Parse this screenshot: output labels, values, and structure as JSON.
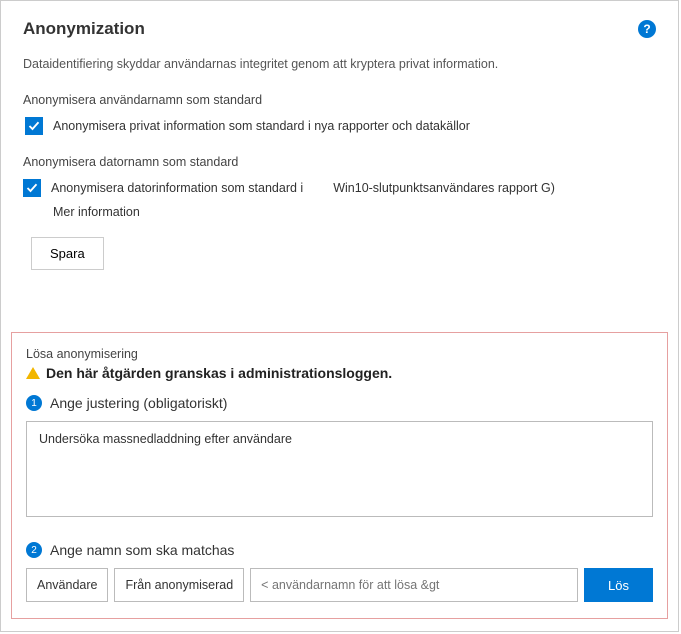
{
  "header": {
    "title": "Anonymization",
    "help_glyph": "?"
  },
  "description": "Dataidentifiering skyddar användarnas integritet genom att kryptera privat information.",
  "section1": {
    "label": "Anonymisera användarnamn som standard",
    "check_label": "Anonymisera privat information som standard i nya rapporter och datakällor"
  },
  "section2": {
    "label": "Anonymisera datornamn som standard",
    "check_label": "Anonymisera datorinformation som standard i",
    "extra": "Win10-slutpunktsanvändares rapport G)",
    "more_info": "Mer information"
  },
  "save_label": "Spara",
  "resolve": {
    "title": "Lösa anonymisering",
    "warning": "Den här åtgärden granskas i administrationsloggen.",
    "step1_num": "1",
    "step1_label": "Ange justering (obligatoriskt)",
    "justification_value": "Undersöka massnedladdning efter användare",
    "step2_num": "2",
    "step2_label": "Ange namn som ska matchas",
    "type_select": "Användare",
    "from_select": "Från anonymiserad",
    "name_placeholder": "< användarnamn för att lösa &gt",
    "resolve_btn": "Lös"
  }
}
